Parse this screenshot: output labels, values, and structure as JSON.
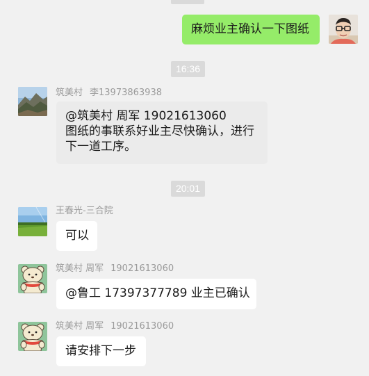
{
  "messages": [
    {
      "id": "m1",
      "direction": "outgoing",
      "text": "麻烦业主确认一下图纸"
    },
    {
      "id": "m2",
      "timestamp": "16:36",
      "direction": "incoming",
      "sender_name": "筑美村",
      "sender_extra": "李13973863938",
      "lines": [
        "@筑美村 周军  19021613060",
        "图纸的事联系好业主尽快确认，进行",
        "下一道工序。"
      ]
    },
    {
      "id": "m3",
      "timestamp": "20:01",
      "direction": "incoming",
      "sender_name": "王春光-三合院",
      "text": "可以"
    },
    {
      "id": "m4",
      "direction": "incoming",
      "sender_name": "筑美村 周军",
      "sender_extra": "19021613060",
      "text": "@鲁工 17397377789 业主已确认"
    },
    {
      "id": "m5",
      "direction": "incoming",
      "sender_name": "筑美村 周军",
      "sender_extra": "19021613060",
      "text": "请安排下一步"
    }
  ],
  "colors": {
    "background": "#f1f1f1",
    "outgoing_bubble": "#95ec69",
    "incoming_bubble": "#ffffff",
    "highlighted_bubble": "#ebebeb",
    "timestamp_pill": "#dadada",
    "sender_text": "#9a9a9a"
  },
  "avatars": {
    "self": "man-with-glasses-avatar",
    "li": "mountain-landscape-avatar",
    "wang": "green-field-avatar",
    "zhou": "cartoon-bear-avatar"
  }
}
